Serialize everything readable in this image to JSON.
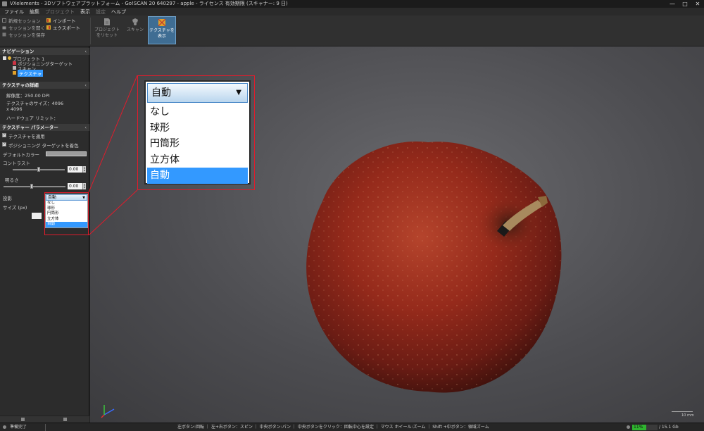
{
  "window": {
    "title": "VXelements - 3Dソフトウェアプラットフォーム - Go!SCAN 20 640297 - apple - ライセンス 有効期限 (スキャナー: 9 日)",
    "minimize": "—",
    "maximize": "□",
    "close": "✕"
  },
  "menu": {
    "items": [
      "ファイル",
      "編集",
      "プロジェクト",
      "表示",
      "設定",
      "ヘルプ"
    ]
  },
  "ribbon": {
    "new_session": "新規セッション",
    "open_session": "セッションを開く",
    "save_session": "セッションを保存",
    "import": "インポート",
    "export": "エクスポート",
    "reset_project_line1": "プロジェクト",
    "reset_project_line2": "をリセット",
    "scan": "スキャン",
    "show_texture_line1": "テクスチャを",
    "show_texture_line2": "表示"
  },
  "navigation": {
    "header": "ナビゲーション",
    "project": "プロジェクト 1",
    "positioning_targets": "ポジショニングターゲット",
    "scan": "スキャン",
    "texture": "テクスチャ"
  },
  "texture_details": {
    "header": "テクスチャの詳細",
    "resolution": "解像度：250.00 DPI",
    "size_line1": "テクスチャのサイズ：4096",
    "size_line2": "x 4096",
    "hw_limit": "ハードウェア リミット："
  },
  "texture_params": {
    "header": "テクスチャー パラメーター",
    "apply_texture": "テクスチャを適用",
    "color_targets": "ポジショニング ターゲットを着色",
    "default_color": "デフォルトカラー",
    "contrast": "コントラスト",
    "contrast_value": "0.00",
    "brightness": "明るさ",
    "brightness_value": "0.00",
    "projection": "投影",
    "size": "サイズ (px)",
    "contrast_level": 0.5,
    "brightness_level": 0.45
  },
  "projection_dropdown": {
    "selected": "自動",
    "options": [
      "なし",
      "球形",
      "円筒形",
      "立方体",
      "自動"
    ],
    "highlighted_index": 4
  },
  "viewport": {
    "scale_label": "10 mm"
  },
  "status": {
    "ready": "準備完了",
    "hints": "左ボタン:回転 ｜ 左+右ボタン：スピン ｜ 中央ボタン:パン ｜ 中央ボタンをクリック：回転中心を設定 ｜ マウス ホイール:ズーム ｜ Shift +中ボタン：領域ズーム",
    "memory_percent": "11%",
    "memory_total": "/ 15.1 Gb",
    "memory_fraction": 0.11
  },
  "colors": {
    "accent_blue": "#3399ff",
    "highlight_red": "#e01c2c",
    "apple_red": "#9a2a1c"
  }
}
